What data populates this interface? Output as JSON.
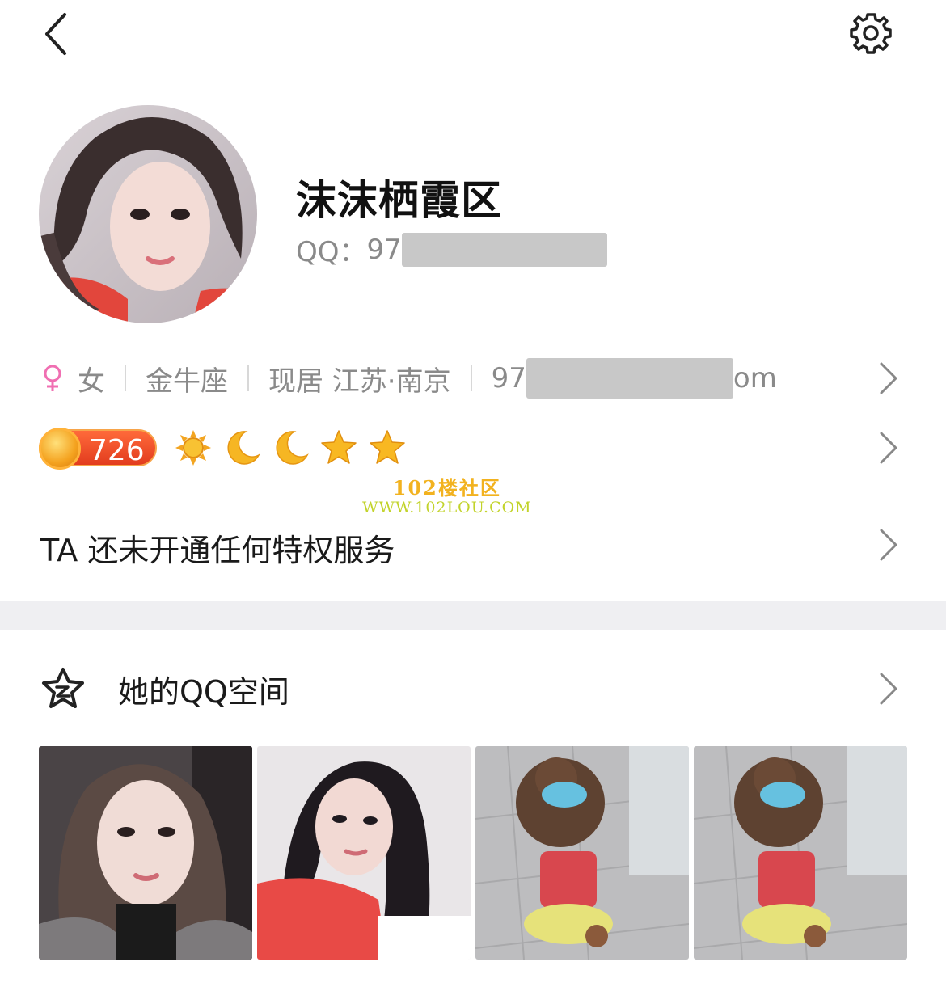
{
  "profile": {
    "nickname": "沫沫栖霞区",
    "qq_label": "QQ：",
    "qq_visible_prefix": "97"
  },
  "info": {
    "gender_icon": "female-icon",
    "gender": "女",
    "zodiac": "金牛座",
    "location": "现居 江苏·南京",
    "email_prefix": "97",
    "email_suffix": "om"
  },
  "level": {
    "value": "726",
    "icons": [
      "sun-icon",
      "moon-icon",
      "moon-icon",
      "star-icon",
      "star-icon"
    ]
  },
  "watermark": {
    "line1": "102楼社区",
    "line2": "WWW.102LOU.COM"
  },
  "privilege": {
    "text": "TA 还未开通任何特权服务"
  },
  "qzone": {
    "label": "她的QQ空间",
    "icon": "qzone-star-icon",
    "photos": [
      "photo-1",
      "photo-2",
      "photo-3",
      "photo-4"
    ]
  },
  "colors": {
    "female_pink": "#f06fb2",
    "muted_text": "#8a8a8a",
    "band": "#efeff2",
    "level_orange": "#e23c1e"
  }
}
